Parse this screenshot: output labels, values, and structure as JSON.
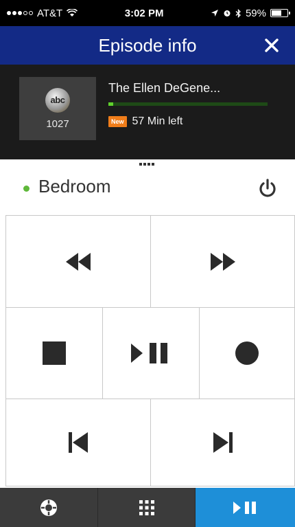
{
  "status_bar": {
    "carrier": "AT&T",
    "time": "3:02 PM",
    "battery": "59%"
  },
  "header": {
    "title": "Episode info",
    "close_icon": "close-icon"
  },
  "episode": {
    "network": "abc",
    "channel": "1027",
    "title": "The Ellen DeGene...",
    "badge": "New",
    "time_left": "57 Min left",
    "progress": 0.03,
    "progress_color": "#5fd12d"
  },
  "room": {
    "name": "Bedroom",
    "status_color": "#5fb83a",
    "power_icon": "power-icon"
  },
  "controls": [
    {
      "name": "rewind-button",
      "icon": "rewind-icon"
    },
    {
      "name": "fast-forward-button",
      "icon": "fast-forward-icon"
    },
    {
      "name": "stop-button",
      "icon": "stop-icon"
    },
    {
      "name": "play-pause-button",
      "icon": "play-pause-icon"
    },
    {
      "name": "record-button",
      "icon": "record-icon"
    },
    {
      "name": "skip-back-button",
      "icon": "skip-back-icon"
    },
    {
      "name": "skip-forward-button",
      "icon": "skip-forward-icon"
    }
  ],
  "tabs": [
    {
      "name": "tab-navigation",
      "icon": "dpad-icon",
      "active": false
    },
    {
      "name": "tab-keypad",
      "icon": "keypad-icon",
      "active": false
    },
    {
      "name": "tab-playback",
      "icon": "play-pause-icon",
      "active": true
    }
  ],
  "colors": {
    "header_bg": "#132a86",
    "active_tab": "#1e8fd8",
    "new_badge": "#f07d1a"
  }
}
